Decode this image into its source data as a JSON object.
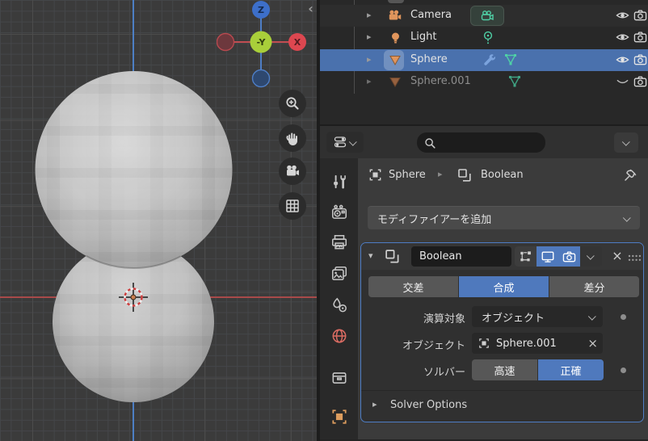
{
  "viewport": {
    "gizmo": {
      "z": "Z",
      "x": "X",
      "center": "-Y"
    },
    "collapse_arrow": "‹"
  },
  "outliner": {
    "rows": [
      {
        "name": "Camera"
      },
      {
        "name": "Light"
      },
      {
        "name": "Sphere"
      },
      {
        "name": "Sphere.001"
      }
    ]
  },
  "properties": {
    "search": {
      "placeholder": ""
    },
    "breadcrumb": {
      "object": "Sphere",
      "modifier": "Boolean"
    },
    "add_modifier_label": "モディファイアーを追加",
    "modifier": {
      "name": "Boolean",
      "operations": [
        {
          "label": "交差"
        },
        {
          "label": "合成"
        },
        {
          "label": "差分"
        }
      ],
      "active_operation": "合成",
      "operand_type_label": "演算対象",
      "operand_type_value": "オブジェクト",
      "object_label": "オブジェクト",
      "object_value": "Sphere.001",
      "solver_label": "ソルバー",
      "solver_modes": [
        {
          "label": "高速"
        },
        {
          "label": "正確"
        }
      ],
      "active_solver": "正確",
      "solver_options_label": "Solver Options"
    }
  },
  "colors": {
    "accent_blue": "#4f79bd",
    "selection_blue": "#4a71ad",
    "axis_x_red": "#a84a4a",
    "axis_z_blue": "#4d7fc4",
    "object_orange": "#e0955c",
    "data_teal": "#4fd0a6",
    "modifier_wrench_blue": "#7ba3dd"
  }
}
